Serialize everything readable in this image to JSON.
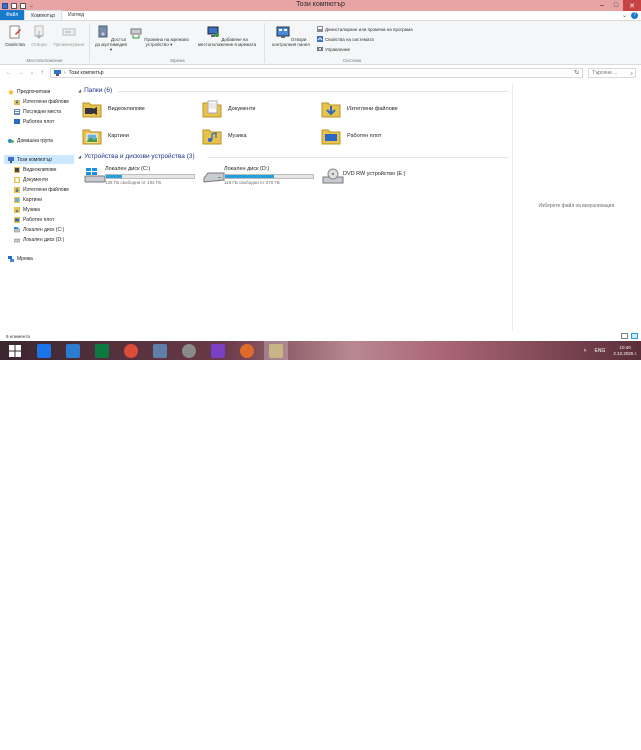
{
  "window": {
    "title": "Този компютър",
    "controls": {
      "minimize": "–",
      "maximize": "□",
      "close": "✕"
    }
  },
  "ribbon": {
    "tabs": [
      {
        "label": "Файл"
      },
      {
        "label": "Компютър"
      },
      {
        "label": "Изглед"
      }
    ],
    "help": "?",
    "groups": {
      "location": {
        "label": "Местоположение",
        "properties": "Свойства",
        "open": "Отвори",
        "rename": "Преименуване"
      },
      "network": {
        "label": "Мрежа",
        "access_media": "Достъп до мултимедия ▾",
        "map_drive": "Промяна на мрежово устройство ▾",
        "add_location": "Добавяне на местоположение в мрежата"
      },
      "system": {
        "label": "Система",
        "open_control_panel": "Отвори контролния панел",
        "uninstall": "Деинсталиране или промяна на програма",
        "system_properties": "Свойства на системата",
        "manage": "Управление"
      }
    }
  },
  "address": {
    "back": "←",
    "forward": "→",
    "recent": "⌄",
    "up": "↑",
    "path": "Този компютър",
    "dropdown": "⌄",
    "refresh": "↻",
    "search_placeholder": "Търсене ...",
    "search_icon": "⌕"
  },
  "nav": {
    "favorites": "Предпочитани",
    "fav_items": [
      "Изтеглени файлове",
      "Последни места",
      "Работен плот"
    ],
    "homegroup": "Домашна група",
    "this_pc": "Този компютър",
    "pc_items": [
      "Видеоклипове",
      "Документи",
      "Изтеглени файлове",
      "Картини",
      "Музика",
      "Работен плот",
      "Локален диск (C:)",
      "Локален диск (D:)"
    ],
    "network": "Мрежа"
  },
  "content": {
    "folders_header": "Папки (6)",
    "folders": [
      "Видеоклипове",
      "Документи",
      "Изтеглени файлове",
      "Картини",
      "Музика",
      "Работен плот"
    ],
    "devices_header": "Устройства и дискови устройства (3)",
    "drives": [
      {
        "name": "Локален диск (C:)",
        "free": "138 ГБ свободни от 194 ГБ",
        "used_fraction": 0.18
      },
      {
        "name": "Локален диск (D:)",
        "free": "118 ГБ свободни от 270 ГБ",
        "used_fraction": 0.56
      },
      {
        "name": "DVD RW устройство (E:)"
      }
    ]
  },
  "preview": {
    "text": "Изберете файл за визуализация."
  },
  "status": {
    "items": "9 елемента"
  },
  "taskbar": {
    "lang": "ENG",
    "time": "10:40",
    "date": "2.12.2025 г.",
    "tray_arrow": "˄",
    "colors": [
      "#1a73e8",
      "#2a7dd1",
      "#0c7a3e",
      "#dd4b39",
      "#5f7fa8",
      "#8a8a8a",
      "#7b3fc4",
      "#e06a2c",
      "#c9b486"
    ]
  }
}
